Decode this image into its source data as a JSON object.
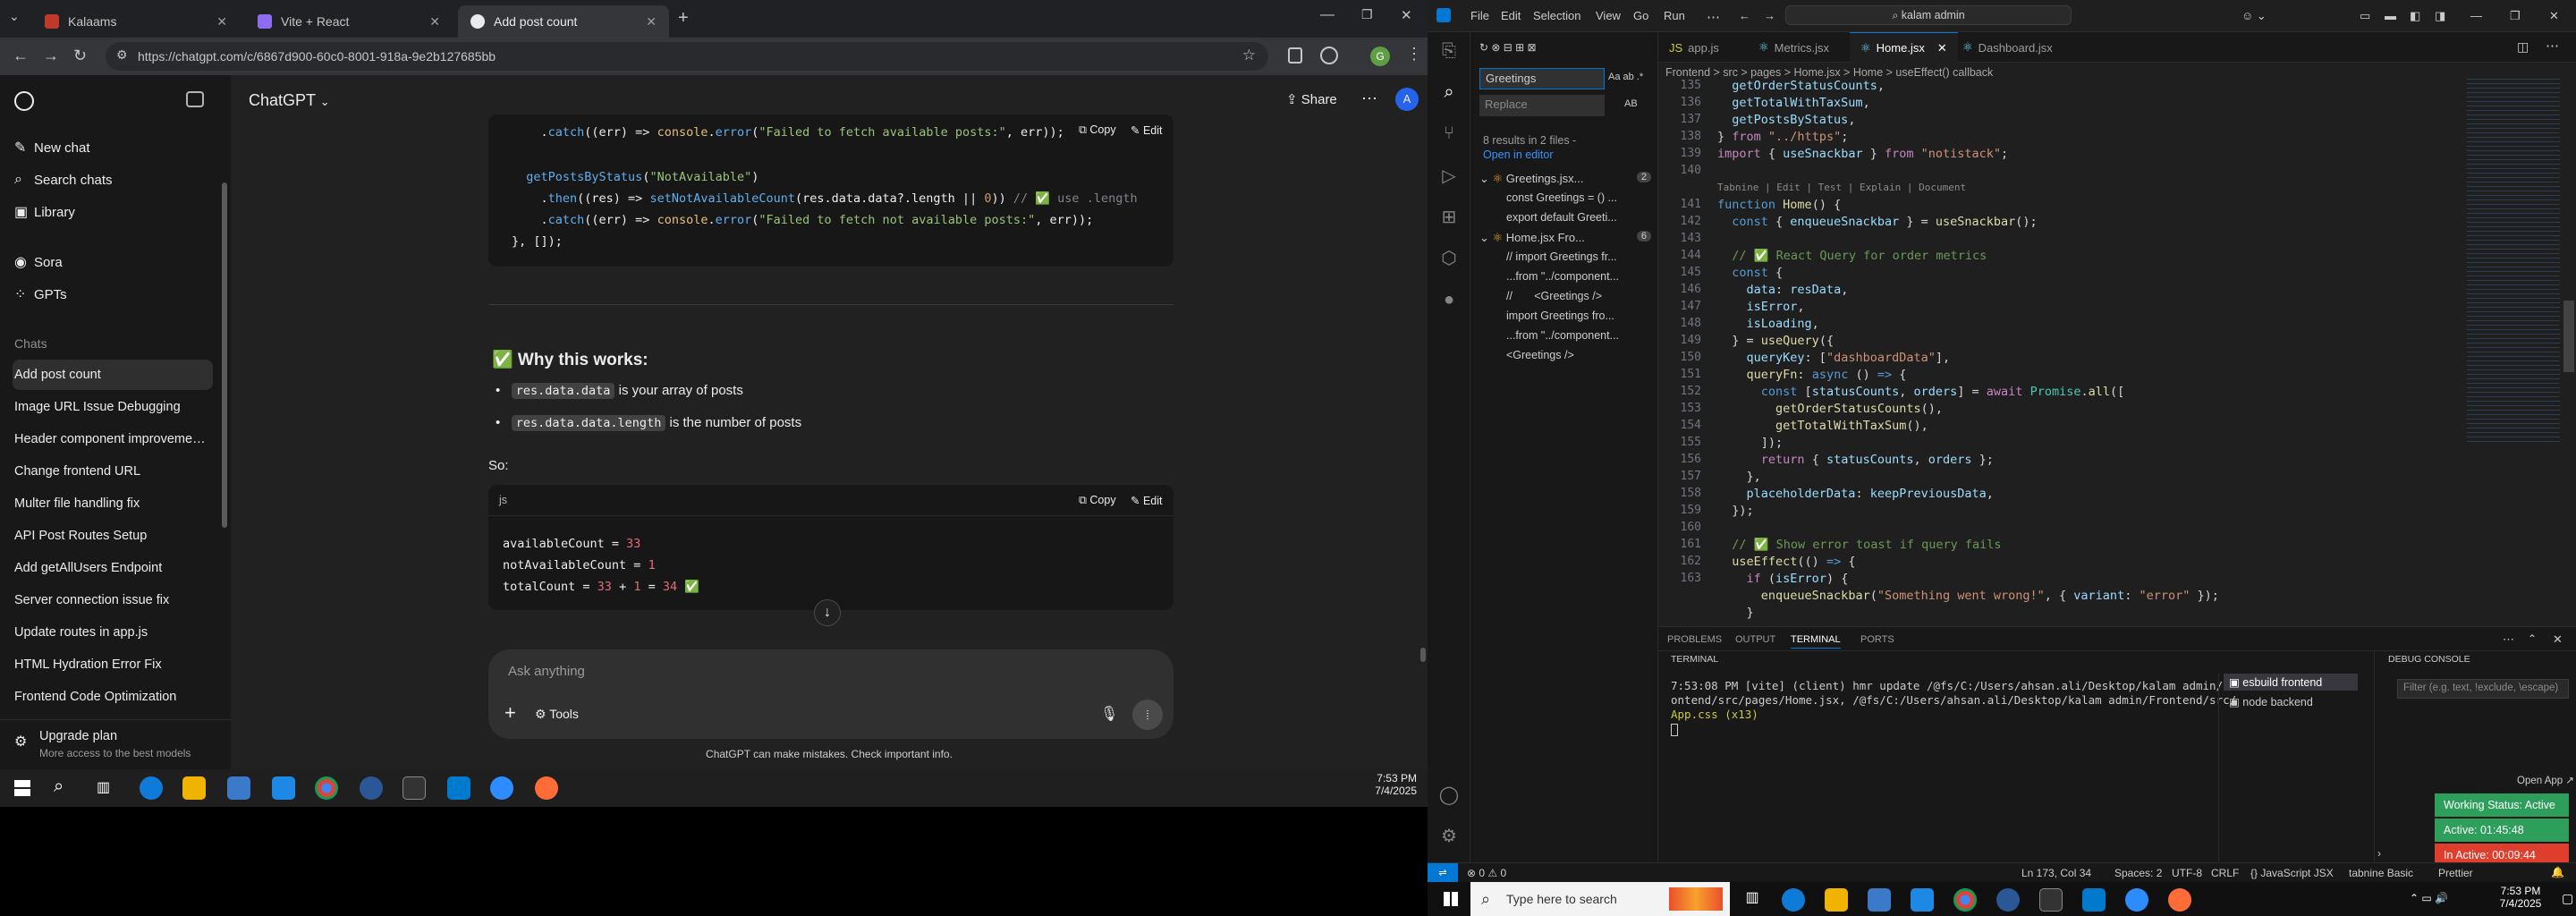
{
  "chrome": {
    "tabs": [
      {
        "label": "Kalaams",
        "active": false
      },
      {
        "label": "Vite + React",
        "active": false
      },
      {
        "label": "Add post count",
        "active": true
      }
    ],
    "url": "https://chatgpt.com/c/6867d900-60c0-8001-918a-9e2b127685bb"
  },
  "chatgpt": {
    "title": "ChatGPT",
    "share_label": "Share",
    "avatar_letter": "A",
    "sidebar": {
      "top_items": [
        "New chat",
        "Search chats",
        "Library"
      ],
      "apps": [
        "Sora",
        "GPTs"
      ],
      "chats_heading": "Chats",
      "chats": [
        "Add post count",
        "Image URL Issue Debugging",
        "Header component improveme…",
        "Change frontend URL",
        "Multer file handling fix",
        "API Post Routes Setup",
        "Add getAllUsers Endpoint",
        "Server connection issue fix",
        "Update routes in app.js",
        "HTML Hydration Error Fix",
        "Frontend Code Optimization"
      ],
      "upgrade_title": "Upgrade plan",
      "upgrade_sub": "More access to the best models"
    },
    "code1": {
      "copy": "Copy",
      "edit": "Edit",
      "lines": [
        ".catch((err) => console.error(\"Failed to fetch available posts:\", err));",
        "",
        "getPostsByStatus(\"NotAvailable\")",
        "  .then((res) => setNotAvailableCount(res.data.data?.length || 0)) // ✅ use .length",
        "  .catch((err) => console.error(\"Failed to fetch not available posts:\", err));",
        "}, []);"
      ]
    },
    "why_heading": "✅ Why this works:",
    "bullets": [
      {
        "code": "res.data.data",
        "text": "is your array of posts"
      },
      {
        "code": "res.data.data.length",
        "text": "is the number of posts"
      }
    ],
    "so_label": "So:",
    "code2": {
      "lang": "js",
      "copy": "Copy",
      "edit": "Edit",
      "lines": [
        "availableCount = 33",
        "notAvailableCount = 1",
        "totalCount = 33 + 1 = 34 ✅"
      ]
    },
    "composer": {
      "placeholder": "Ask anything",
      "tools": "Tools"
    },
    "disclaimer": "ChatGPT can make mistakes. Check important info."
  },
  "left_taskbar": {
    "time": "7:53 PM",
    "date": "7/4/2025"
  },
  "vscode": {
    "menu": [
      "File",
      "Edit",
      "Selection",
      "View",
      "Go",
      "Run"
    ],
    "command_center": "kalam admin",
    "search": {
      "query": "Greetings",
      "replace_placeholder": "Replace",
      "results_summary": "8 results in 2 files -",
      "open_in_editor": "Open in editor",
      "files": [
        {
          "name": "Greetings.jsx...",
          "count": "2",
          "matches": [
            "const Greetings = () ...",
            "export default Greeti..."
          ]
        },
        {
          "name": "Home.jsx Fro...",
          "count": "6",
          "matches": [
            "// import Greetings fr...",
            "...from \"../component...",
            "//       <Greetings />",
            "import Greetings fro...",
            "...from \"../component...",
            "<Greetings />"
          ]
        }
      ]
    },
    "tabs": [
      "app.js",
      "Metrics.jsx",
      "Home.jsx",
      "Dashboard.jsx"
    ],
    "breadcrumb": "Frontend > src > pages > Home.jsx > Home > useEffect() callback",
    "codelens": "Tabnine | Edit | Test | Explain | Document",
    "line_numbers": [
      "135",
      "136",
      "137",
      "138",
      "139",
      "140",
      "",
      "141",
      "142",
      "143",
      "144",
      "145",
      "146",
      "147",
      "148",
      "149",
      "150",
      "151",
      "152",
      "153",
      "154",
      "155",
      "156",
      "157",
      "158",
      "159",
      "160",
      "161",
      "162",
      "163"
    ],
    "panel_tabs": [
      "PROBLEMS",
      "OUTPUT",
      "TERMINAL",
      "PORTS"
    ],
    "terminal_label": "TERMINAL",
    "terminal_lines": [
      "7:53:08 PM [vite] (client) hmr update /@fs/C:/Users/ahsan.ali/Desktop/kalam admin/Fr",
      "ontend/src/pages/Home.jsx, /@fs/C:/Users/ahsan.ali/Desktop/kalam admin/Frontend/src/",
      "App.css (x13)"
    ],
    "terminals": [
      "esbuild  frontend",
      "node  backend"
    ],
    "debug_console": "DEBUG CONSOLE",
    "debug_filter": "Filter (e.g. text, !exclude, \\escape)",
    "status": {
      "left": "⊗ 0  ⚠ 0",
      "position": "Ln 173, Col 34",
      "spaces": "Spaces: 2",
      "encoding": "UTF-8",
      "eol": "CRLF",
      "lang": "{} JavaScript JSX",
      "tabnine": "tabnine Basic",
      "prettier": "Prettier"
    },
    "working": {
      "open_app": "Open App ↗",
      "status": "Working Status: Active",
      "active": "Active: 01:45:48",
      "inactive": "In Active: 00:09:44"
    }
  },
  "right_taskbar": {
    "search_placeholder": "Type here to search",
    "time": "7:53 PM",
    "date": "7/4/2025"
  }
}
